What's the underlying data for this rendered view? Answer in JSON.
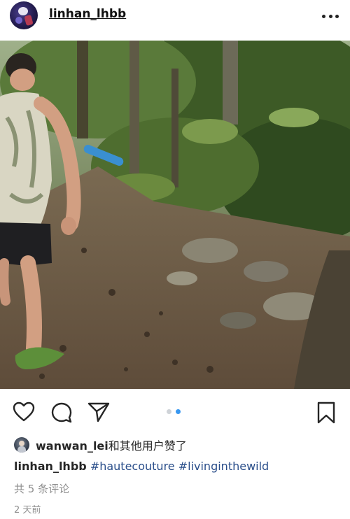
{
  "header": {
    "username": "linhan_lhbb",
    "more_icon": "more-horizontal-icon"
  },
  "photo": {
    "alt": "",
    "carousel": {
      "count": 2,
      "active_index": 1
    }
  },
  "actions": {
    "like_icon": "heart-icon",
    "comment_icon": "comment-icon",
    "share_icon": "send-icon",
    "save_icon": "bookmark-icon",
    "accent": "#3897f0"
  },
  "likes": {
    "user": "wanwan_lei",
    "suffix": "和其他用户赞了"
  },
  "caption": {
    "user": "linhan_lhbb",
    "tags": "#hautecouture #livinginthewild",
    "tag_color": "#2a4e8a"
  },
  "comments_link": "共 5 条评论",
  "timestamp": "2 天前"
}
